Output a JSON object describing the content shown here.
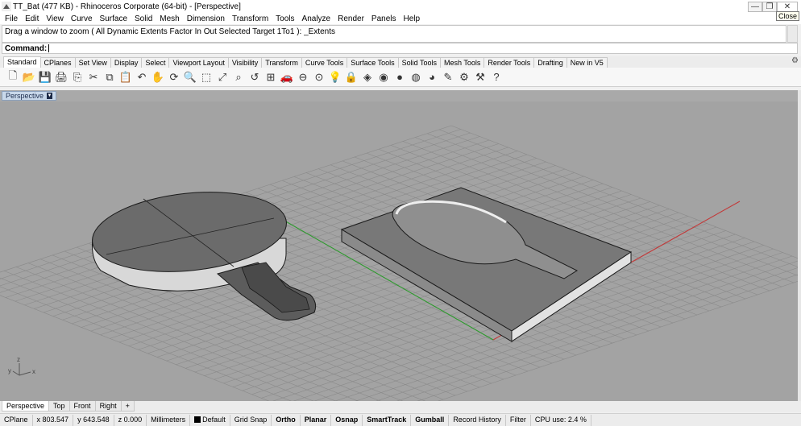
{
  "window": {
    "title": "TT_Bat (477 KB) - Rhinoceros Corporate (64-bit) - [Perspective]",
    "buttons": [
      "—",
      "❐",
      "✕"
    ],
    "tooltip": "Close"
  },
  "menu": [
    "File",
    "Edit",
    "View",
    "Curve",
    "Surface",
    "Solid",
    "Mesh",
    "Dimension",
    "Transform",
    "Tools",
    "Analyze",
    "Render",
    "Panels",
    "Help"
  ],
  "command": {
    "history": "Drag a window to zoom ( All  Dynamic  Extents  Factor  In  Out  Selected  Target  1To1 ): _Extents",
    "prompt": "Command:",
    "value": ""
  },
  "toolbar_tabs": [
    "Standard",
    "CPlanes",
    "Set View",
    "Display",
    "Select",
    "Viewport Layout",
    "Visibility",
    "Transform",
    "Curve Tools",
    "Surface Tools",
    "Solid Tools",
    "Mesh Tools",
    "Render Tools",
    "Drafting",
    "New in V5"
  ],
  "toolbar_icons": [
    "new-icon",
    "open-icon",
    "save-icon",
    "print-icon",
    "import-icon",
    "cut-icon",
    "copy-icon",
    "paste-icon",
    "undo-icon",
    "pan-icon",
    "rotate-view-icon",
    "zoom-icon",
    "zoom-window-icon",
    "zoom-extents-icon",
    "zoom-selected-icon",
    "undo-view-icon",
    "four-viewports-icon",
    "car-icon",
    "construction-plane-icon",
    "camera-icon",
    "light-icon",
    "lock-icon",
    "material-icon",
    "color-wheel-icon",
    "shade-icon",
    "render-icon",
    "sphere-icon",
    "pencil-icon",
    "settings-icon",
    "options-icon",
    "help-icon"
  ],
  "viewport": {
    "label": "Perspective",
    "axis_labels": {
      "x": "x",
      "y": "y",
      "z": "z"
    },
    "colors": {
      "background": "#a3a3a3",
      "grid": "#8c8c8c",
      "x_axis": "#c23a3a",
      "y_axis": "#2e9a2e",
      "object": "#6d6d6d",
      "edge": "#1a1a1a"
    }
  },
  "viewport_tabs": [
    "Perspective",
    "Top",
    "Front",
    "Right",
    "+"
  ],
  "status": {
    "cplane": "CPlane",
    "x": "x 803.547",
    "y": "y 643.548",
    "z": "z 0.000",
    "units": "Millimeters",
    "layer": "Default",
    "toggles": [
      "Grid Snap",
      "Ortho",
      "Planar",
      "Osnap",
      "SmartTrack",
      "Gumball",
      "Record History",
      "Filter"
    ],
    "cpu": "CPU use: 2.4 %"
  }
}
